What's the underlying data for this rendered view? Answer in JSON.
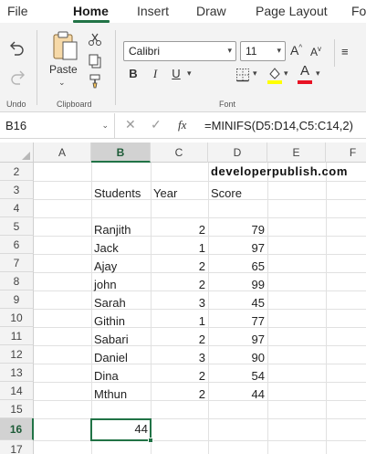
{
  "ribbon_tabs": [
    "File",
    "Home",
    "Insert",
    "Draw",
    "Page Layout",
    "Fo"
  ],
  "active_tab": "Home",
  "groups": {
    "undo": {
      "label": "Undo"
    },
    "clipboard": {
      "label": "Clipboard",
      "paste_label": "Paste"
    },
    "font": {
      "label": "Font",
      "font_name": "Calibri",
      "font_size": "11",
      "bold": "B",
      "italic": "I",
      "underline": "U",
      "grow_font": "A",
      "shrink_font": "A",
      "font_color_glyph": "A",
      "highlight_color": "#ffff00",
      "font_color": "#e81123"
    }
  },
  "formula_bar": {
    "name_box": "B16",
    "cancel_glyph": "✕",
    "enter_glyph": "✓",
    "fx_label": "fx",
    "formula": "=MINIFS(D5:D14,C5:C14,2)"
  },
  "grid": {
    "columns": [
      "A",
      "B",
      "C",
      "D",
      "E",
      "F"
    ],
    "active_column": "B",
    "rows": [
      "2",
      "3",
      "4",
      "5",
      "6",
      "7",
      "8",
      "9",
      "10",
      "11",
      "12",
      "13",
      "14",
      "15",
      "16",
      "17"
    ],
    "active_row": "16",
    "watermark": "developerpublish.com",
    "headers": {
      "students": "Students",
      "year": "Year",
      "score": "Score"
    },
    "records": [
      {
        "name": "Ranjith",
        "year": "2",
        "score": "79"
      },
      {
        "name": "Jack",
        "year": "1",
        "score": "97"
      },
      {
        "name": "Ajay",
        "year": "2",
        "score": "65"
      },
      {
        "name": "john",
        "year": "2",
        "score": "99"
      },
      {
        "name": "Sarah",
        "year": "3",
        "score": "45"
      },
      {
        "name": "Githin",
        "year": "1",
        "score": "77"
      },
      {
        "name": "Sabari",
        "year": "2",
        "score": "97"
      },
      {
        "name": "Daniel",
        "year": "3",
        "score": "90"
      },
      {
        "name": "Dina",
        "year": "2",
        "score": "54"
      },
      {
        "name": "Mthun",
        "year": "2",
        "score": "44"
      }
    ],
    "result": "44"
  },
  "colors": {
    "accent": "#217346",
    "ribbon_bg": "#f3f3f3"
  }
}
